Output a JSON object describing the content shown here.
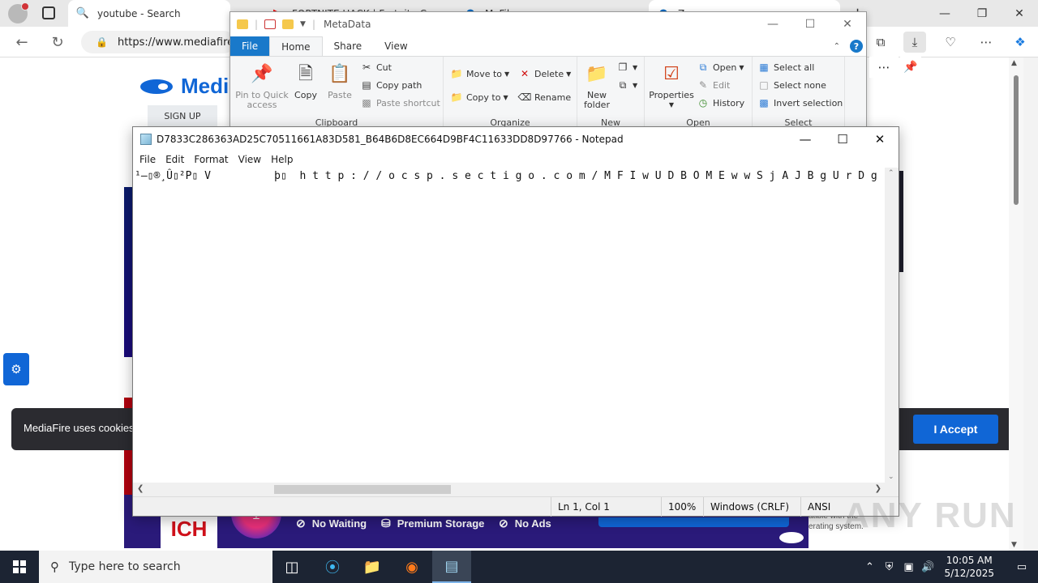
{
  "browser": {
    "tabs": [
      {
        "label": "youtube - Search",
        "icon": "search-icon"
      },
      {
        "label": "FORTNITE HACK | Fortnite C",
        "icon": "youtube-icon"
      },
      {
        "label": "MyFiles",
        "icon": "globe-icon"
      },
      {
        "label": "Zero",
        "icon": "globe-icon"
      }
    ],
    "url": "https://www.mediafire"
  },
  "webpage": {
    "logo_text": "Media",
    "signup_label": "SIGN UP",
    "cookie_text": "MediaFire uses cookies",
    "accept_label": "I Accept",
    "promo_ich": "ICH",
    "features": [
      "No Waiting",
      "Premium Storage",
      "No Ads"
    ],
    "compat_text_1": "atible with the",
    "compat_text_2": "erating system."
  },
  "explorer": {
    "title": "MetaData",
    "tabs": {
      "file": "File",
      "home": "Home",
      "share": "Share",
      "view": "View"
    },
    "clipboard": {
      "pin": "Pin to Quick access",
      "copy": "Copy",
      "paste": "Paste",
      "cut": "Cut",
      "copy_path": "Copy path",
      "paste_shortcut": "Paste shortcut",
      "label": "Clipboard"
    },
    "organize": {
      "move_to": "Move to",
      "copy_to": "Copy to",
      "delete": "Delete",
      "rename": "Rename",
      "label": "Organize"
    },
    "new": {
      "new_folder": "New folder",
      "label": "New"
    },
    "open": {
      "properties": "Properties",
      "open": "Open",
      "edit": "Edit",
      "history": "History",
      "label": "Open"
    },
    "select": {
      "select_all": "Select all",
      "select_none": "Select none",
      "invert": "Invert selection",
      "label": "Select"
    }
  },
  "notepad": {
    "title": "D7833C286363AD25C70511661A83D581_B64B6D8EC664D9BF4C11633DD8D97766 - Notepad",
    "menu": [
      "File",
      "Edit",
      "Format",
      "View",
      "Help"
    ],
    "content": "¹—▯®¸Û▯²P▯ V          þ▯  h t t p : / / o c s p . s e c t i g o . c o m / M F I w U D B O M E w w S j A J B g U r D g",
    "status": {
      "position": "Ln 1, Col 1",
      "zoom": "100%",
      "line_ending": "Windows (CRLF)",
      "encoding": "ANSI"
    }
  },
  "watermark": "ANY RUN",
  "taskbar": {
    "search_placeholder": "Type here to search",
    "time": "10:05 AM",
    "date": "5/12/2025"
  }
}
